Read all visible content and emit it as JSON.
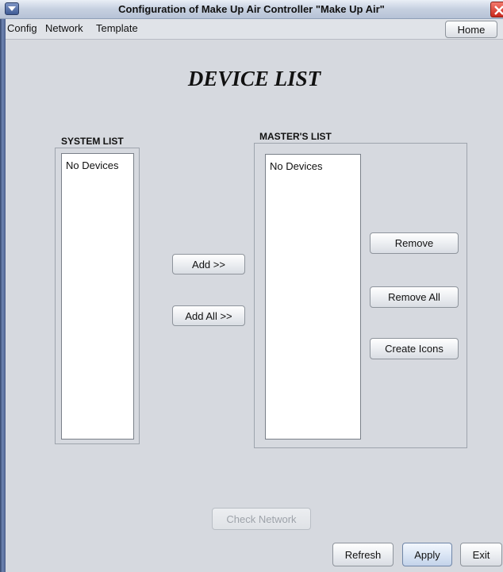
{
  "window": {
    "title": "Configuration of Make Up Air Controller \"Make Up Air\"",
    "menu_icon": "window-menu-icon",
    "close_icon": "close-icon",
    "close_color": "#d3392c"
  },
  "menubar": {
    "items": [
      "Config",
      "Network",
      "Template"
    ],
    "home_label": "Home"
  },
  "page": {
    "title": "DEVICE LIST"
  },
  "system_list": {
    "label": "SYSTEM LIST",
    "items": [
      "No Devices"
    ]
  },
  "masters_list": {
    "label": "MASTER'S LIST",
    "items": [
      "No Devices"
    ]
  },
  "transfer_buttons": {
    "add": "Add >>",
    "add_all": "Add All >>"
  },
  "master_buttons": {
    "remove": "Remove",
    "remove_all": "Remove All",
    "create_icons": "Create Icons"
  },
  "bottom_buttons": {
    "check_network": "Check Network",
    "check_network_enabled": false,
    "refresh": "Refresh",
    "apply": "Apply",
    "exit": "Exit"
  },
  "colors": {
    "background": "#d6d9df",
    "list_background": "#ffffff",
    "disabled_text": "#9ea3aa"
  }
}
